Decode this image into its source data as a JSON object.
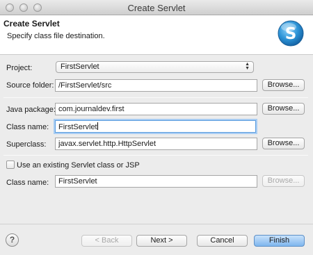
{
  "window": {
    "title": "Create Servlet"
  },
  "header": {
    "title": "Create Servlet",
    "description": "Specify class file destination."
  },
  "form": {
    "project_label": "Project:",
    "project_value": "FirstServlet",
    "source_folder_label": "Source folder:",
    "source_folder_value": "/FirstServlet/src",
    "java_package_label": "Java package:",
    "java_package_value": "com.journaldev.first",
    "class_name_label": "Class name:",
    "class_name_value": "FirstServlet",
    "superclass_label": "Superclass:",
    "superclass_value": "javax.servlet.http.HttpServlet",
    "existing_checkbox_label": "Use an existing Servlet class or JSP",
    "existing_checkbox_checked": false,
    "existing_class_label": "Class name:",
    "existing_class_value": "FirstServlet",
    "browse_label": "Browse..."
  },
  "footer": {
    "help_label": "?",
    "back_label": "< Back",
    "next_label": "Next >",
    "cancel_label": "Cancel",
    "finish_label": "Finish"
  },
  "colors": {
    "primary_button": "#7fb6ee",
    "focus_ring": "#a9cdf3",
    "logo": "#2c93d6"
  }
}
